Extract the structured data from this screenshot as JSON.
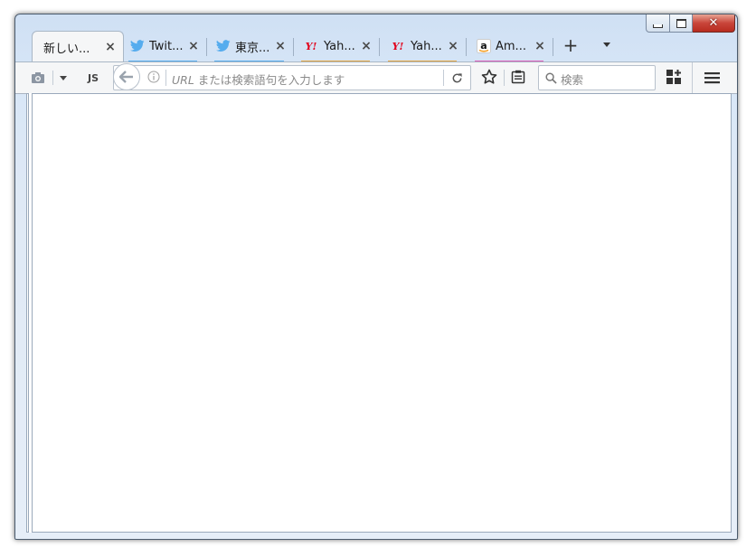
{
  "window": {
    "caption_buttons": [
      "minimize",
      "maximize",
      "close"
    ]
  },
  "tabs": [
    {
      "title": "新しい...",
      "active": true,
      "icon": "none",
      "accent": ""
    },
    {
      "title": "Twit...",
      "active": false,
      "icon": "twitter-icon",
      "accent": "#55acee"
    },
    {
      "title": "東京...",
      "active": false,
      "icon": "twitter-icon",
      "accent": "#55acee"
    },
    {
      "title": "Yah...",
      "active": false,
      "icon": "yahoo-icon",
      "accent": "#e8a63a"
    },
    {
      "title": "Yah...",
      "active": false,
      "icon": "yahoo-icon",
      "accent": "#e8a63a"
    },
    {
      "title": "Am...",
      "active": false,
      "icon": "amazon-icon",
      "accent": "#e05cb8"
    }
  ],
  "toolbar": {
    "js_label": "JS",
    "url_prefix": "URL",
    "url_placeholder": " または検索語句を入力します",
    "search_placeholder": "検索"
  },
  "colors": {
    "twitter": "#55acee",
    "yahoo": "#e8a63a",
    "yahoo_logo": "#e1001c",
    "amazon": "#e05cb8"
  }
}
